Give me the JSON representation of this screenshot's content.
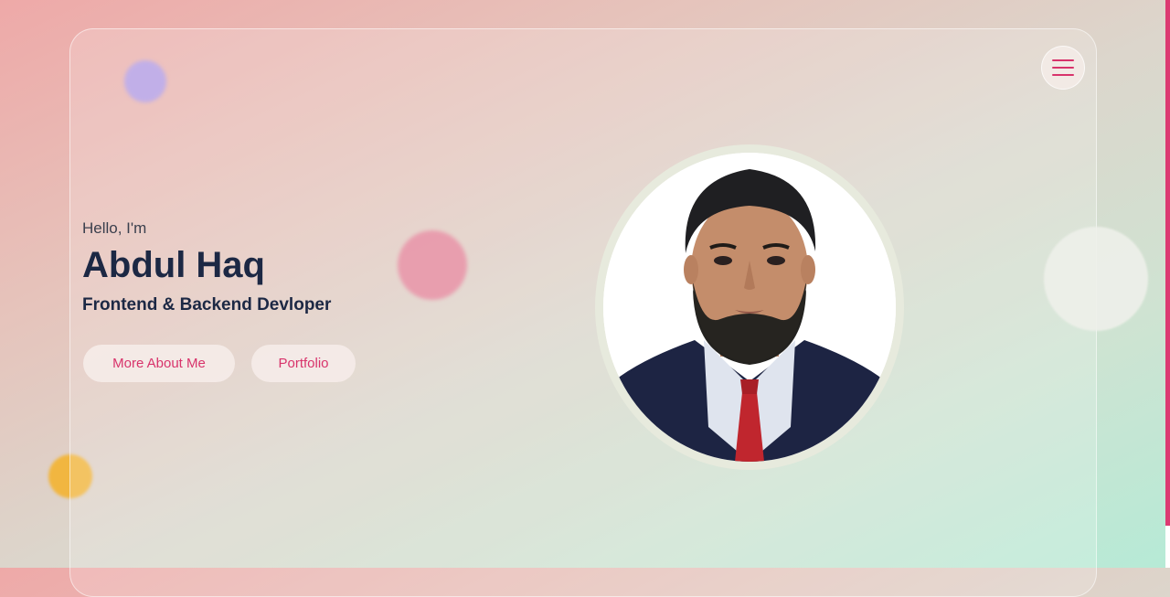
{
  "hero": {
    "greeting": "Hello, I'm",
    "name": "Abdul Haq",
    "role": "Frontend & Backend Devloper"
  },
  "buttons": {
    "more_about": "More About Me",
    "portfolio": "Portfolio"
  },
  "icons": {
    "menu": "hamburger-menu-icon"
  },
  "colors": {
    "accent": "#d8336b",
    "heading": "#1c2844"
  }
}
